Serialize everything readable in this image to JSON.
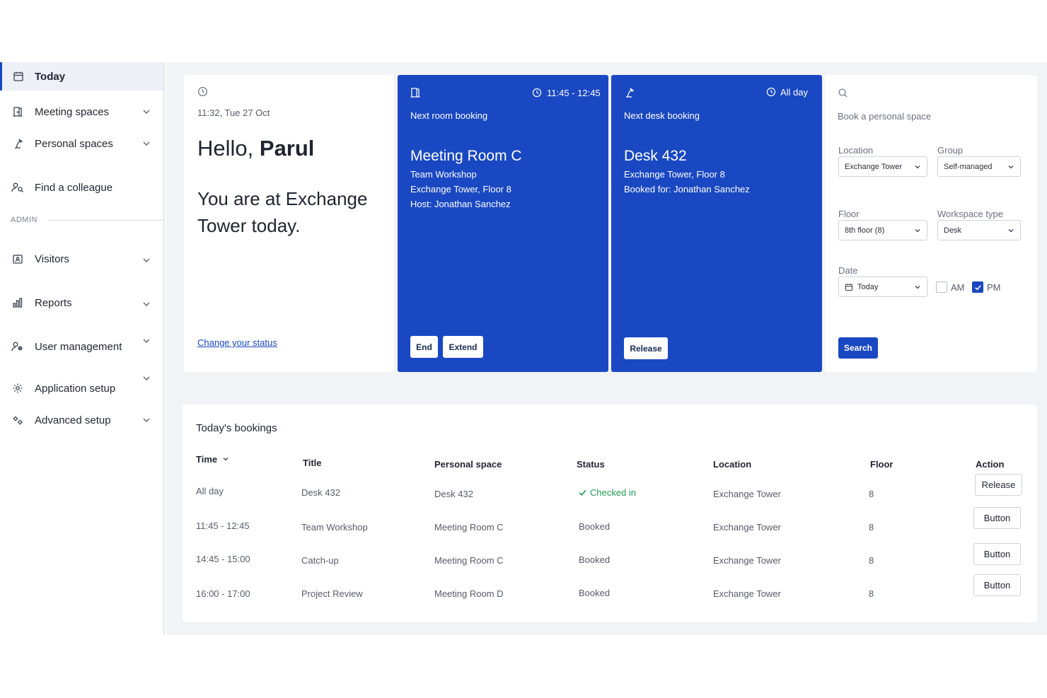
{
  "sidebar": {
    "items": [
      {
        "label": "Today",
        "icon": "calendar-icon"
      },
      {
        "label": "Meeting spaces",
        "icon": "door-icon"
      },
      {
        "label": "Personal spaces",
        "icon": "desk-lamp-icon"
      },
      {
        "label": "Find a colleague",
        "icon": "people-search-icon"
      },
      {
        "label": "Visitors",
        "icon": "visitor-badge-icon"
      },
      {
        "label": "Reports",
        "icon": "bar-chart-icon"
      },
      {
        "label": "User management",
        "icon": "users-gear-icon"
      },
      {
        "label": "Application setup",
        "icon": "gear-icon"
      },
      {
        "label": "Advanced setup",
        "icon": "gears-icon"
      }
    ],
    "admin_label": "ADMIN"
  },
  "welcome": {
    "datetime": "11:32, Tue 27 Oct",
    "greeting": "Hello,",
    "name": "Parul",
    "status_line": "You are at Exchange Tower today.",
    "change_link": "Change your status"
  },
  "room_booking": {
    "time": "11:45 - 12:45",
    "heading": "Next room booking",
    "title": "Meeting Room C",
    "line1": "Team Workshop",
    "line2": "Exchange Tower, Floor 8",
    "line3": "Host: Jonathan Sanchez",
    "end_label": "End",
    "extend_label": "Extend"
  },
  "desk_booking": {
    "time": "All day",
    "heading": "Next desk booking",
    "title": "Desk 432",
    "line1": "Exchange Tower, Floor 8",
    "line2": "Booked for: Jonathan Sanchez",
    "release_label": "Release"
  },
  "book_space": {
    "heading": "Book a personal space",
    "location_label": "Location",
    "location_value": "Exchange Tower",
    "group_label": "Group",
    "group_value": "Self-managed",
    "floor_label": "Floor",
    "floor_value": "8th floor (8)",
    "workspace_label": "Workspace type",
    "workspace_value": "Desk",
    "date_label": "Date",
    "date_value": "Today",
    "am_label": "AM",
    "am_checked": false,
    "pm_label": "PM",
    "pm_checked": true,
    "search_label": "Search"
  },
  "bookings": {
    "title": "Today's bookings",
    "columns": [
      "Time",
      "Title",
      "Personal space",
      "Status",
      "Location",
      "Floor",
      "Action"
    ],
    "rows": [
      {
        "time": "All day",
        "title": "Desk 432",
        "space": "Desk 432",
        "status": "Checked in",
        "location": "Exchange Tower",
        "floor": "8",
        "action": "Release"
      },
      {
        "time": "11:45 - 12:45",
        "title": "Team Workshop",
        "space": "Meeting Room C",
        "status": "Booked",
        "location": "Exchange Tower",
        "floor": "8",
        "action": "Button"
      },
      {
        "time": "14:45 - 15:00",
        "title": "Catch-up",
        "space": "Meeting Room C",
        "status": "Booked",
        "location": "Exchange Tower",
        "floor": "8",
        "action": "Button"
      },
      {
        "time": "16:00 - 17:00",
        "title": "Project Review",
        "space": "Meeting Room D",
        "status": "Booked",
        "location": "Exchange Tower",
        "floor": "8",
        "action": "Button"
      }
    ]
  },
  "colors": {
    "accent": "#1a48c2",
    "checked_in": "#1f9d55",
    "background": "#f2f3f6"
  }
}
